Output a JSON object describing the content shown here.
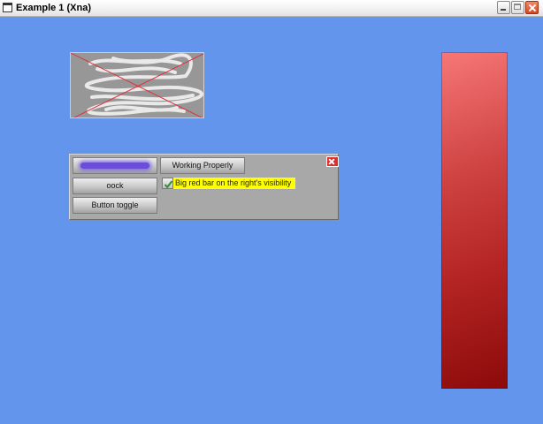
{
  "window": {
    "title": "Example 1 (Xna)",
    "buttons": {
      "minimize_icon": "minimize-icon",
      "maximize_icon": "maximize-icon",
      "close_icon": "close-icon"
    }
  },
  "canvas": {
    "background_color": "#6495ED",
    "red_bar_color": "#C83232"
  },
  "gui": {
    "buttons": {
      "working_label": "Working Properly",
      "oock_label": "oock",
      "toggle_label": "Button toggle"
    },
    "checkbox": {
      "label": "Big red bar on the right's visibility",
      "checked": true,
      "highlight_color": "#FFFF00"
    },
    "close_icon": "close-icon"
  }
}
